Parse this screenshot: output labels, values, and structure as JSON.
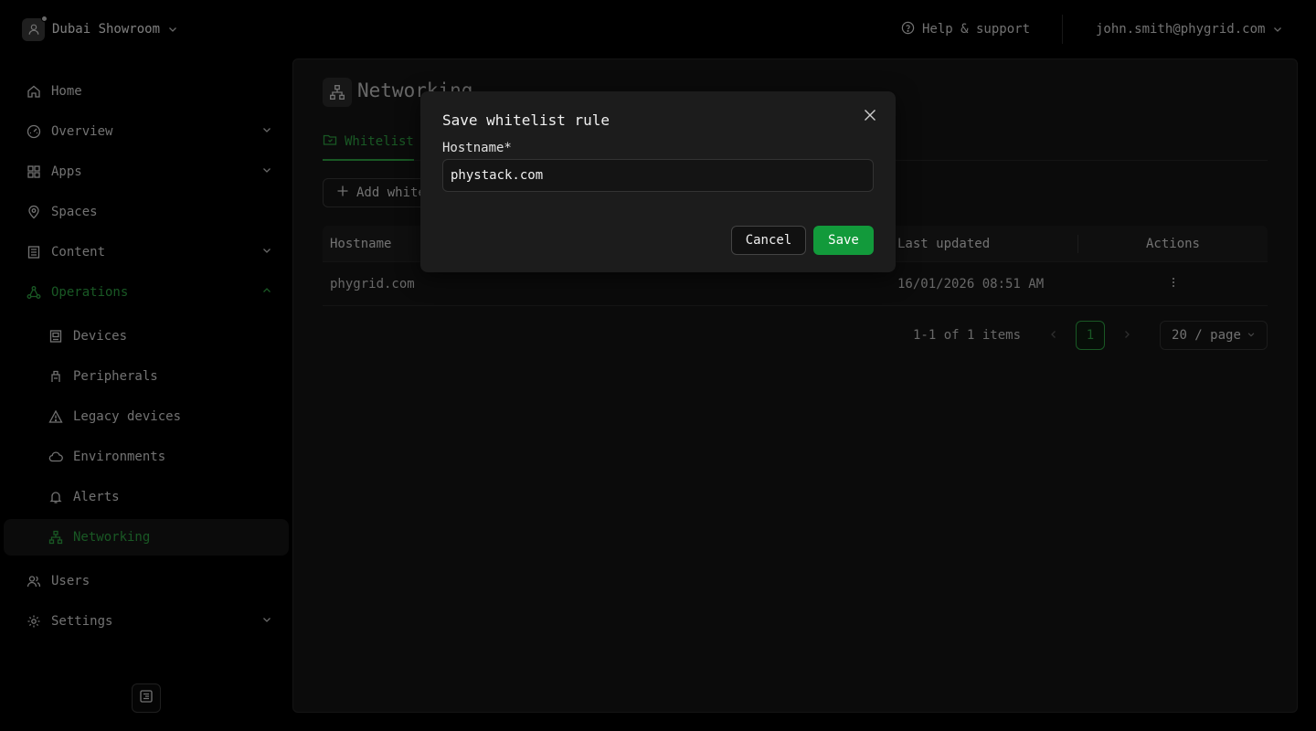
{
  "workspace": {
    "name": "Dubai Showroom"
  },
  "header": {
    "help_label": "Help & support",
    "user_email": "john.smith@phygrid.com"
  },
  "sidebar": {
    "home": "Home",
    "overview": "Overview",
    "apps": "Apps",
    "spaces": "Spaces",
    "content": "Content",
    "operations": "Operations",
    "devices": "Devices",
    "peripherals": "Peripherals",
    "legacy_devices": "Legacy devices",
    "environments": "Environments",
    "alerts": "Alerts",
    "networking": "Networking",
    "users": "Users",
    "settings": "Settings"
  },
  "page": {
    "title": "Networking",
    "tab_whitelist": "Whitelist",
    "add_button": "Add whitelist rule"
  },
  "table": {
    "columns": {
      "hostname": "Hostname",
      "last_updated": "Last updated",
      "actions": "Actions"
    },
    "rows": [
      {
        "hostname": "phygrid.com",
        "last_updated": "16/01/2026 08:51 AM"
      }
    ]
  },
  "pagination": {
    "info": "1-1 of 1 items",
    "current": "1",
    "page_size": "20 / page"
  },
  "modal": {
    "title": "Save whitelist rule",
    "field_label": "Hostname*",
    "field_value": "phystack.com",
    "cancel": "Cancel",
    "save": "Save"
  },
  "colors": {
    "accent": "#2ea043",
    "save_button": "#129a3b",
    "background": "#000000",
    "panel": "#141414",
    "modal": "#1c1c1c"
  }
}
